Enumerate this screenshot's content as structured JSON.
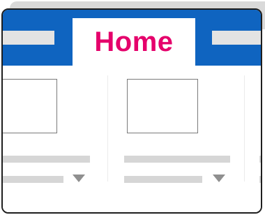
{
  "ribbon": {
    "active_tab": {
      "label": "Home"
    },
    "accent_color": "#0f64c0",
    "active_tab_text_color": "#e5006b"
  },
  "groups": [
    {
      "id": "group-1"
    },
    {
      "id": "group-2"
    },
    {
      "id": "group-3"
    }
  ],
  "icons": {
    "dropdown": "chevron-down-icon"
  }
}
